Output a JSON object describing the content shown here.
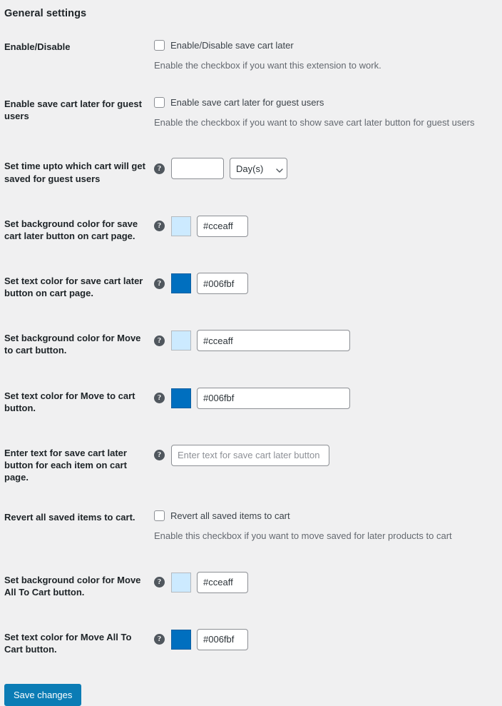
{
  "page": {
    "title": "General settings",
    "background_color": "#f0f0f1"
  },
  "rows": [
    {
      "label": "Enable/Disable",
      "checkbox_label": "Enable/Disable save cart later",
      "description": "Enable the checkbox if you want this extension to work."
    },
    {
      "label": "Enable save cart later for guest users",
      "checkbox_label": "Enable save cart later for guest users",
      "description": "Enable the checkbox if you want to show save cart later button for guest users"
    },
    {
      "label": "Set time upto which cart will get saved for guest users",
      "help_icon": "help-question-icon",
      "input_value": "",
      "select_value": "Day(s)",
      "select_options": [
        "Day(s)"
      ]
    },
    {
      "label": "Set background color for save cart later button on cart page.",
      "help_icon": "help-question-icon",
      "swatch_color": "#cceaff",
      "input_value": "#cceaff"
    },
    {
      "label": "Set text color for save cart later button on cart page.",
      "help_icon": "help-question-icon",
      "swatch_color": "#006fbf",
      "input_value": "#006fbf"
    },
    {
      "label": "Set background color for Move to cart button.",
      "help_icon": "help-question-icon",
      "swatch_color": "#cceaff",
      "input_value": "#cceaff"
    },
    {
      "label": "Set text color for Move to cart button.",
      "help_icon": "help-question-icon",
      "swatch_color": "#006fbf",
      "input_value": "#006fbf"
    },
    {
      "label": "Enter text for save cart later button for each item on cart page.",
      "help_icon": "help-question-icon",
      "input_value": "",
      "placeholder": "Enter text for save cart later button"
    },
    {
      "label": "Revert all saved items to cart.",
      "checkbox_label": "Revert all saved items to cart",
      "description": "Enable this checkbox if you want to move saved for later products to cart"
    },
    {
      "label": "Set background color for Move All To Cart button.",
      "help_icon": "help-question-icon",
      "swatch_color": "#cceaff",
      "input_value": "#cceaff"
    },
    {
      "label": "Set text color for Move All To Cart button.",
      "help_icon": "help-question-icon",
      "swatch_color": "#006fbf",
      "input_value": "#006fbf"
    }
  ],
  "submit": {
    "save_label": "Save changes",
    "color": "#0b7cb5"
  },
  "icons": {
    "help": "?",
    "chevron_down": "chevron-down-icon"
  }
}
